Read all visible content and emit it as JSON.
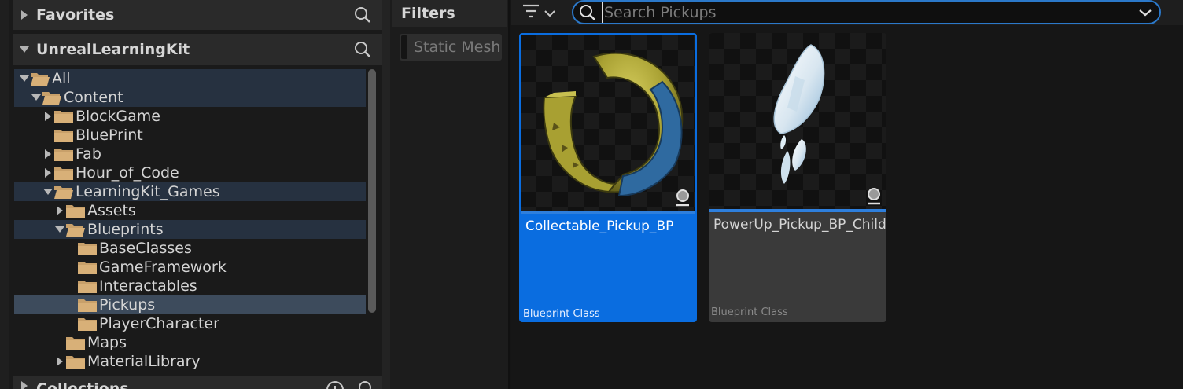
{
  "colors": {
    "accent": "#0a6de0",
    "folder": "#c8a06a",
    "selected_row": "#3d4b5c",
    "path_row": "#263140"
  },
  "sources": {
    "favorites": {
      "title": "Favorites",
      "icon": "search-icon"
    },
    "project": {
      "title": "UnrealLearningKit",
      "icon": "search-icon"
    },
    "collections": {
      "title": "Collections",
      "icons": [
        "add-icon",
        "search-icon"
      ]
    },
    "tree": [
      {
        "label": "All",
        "depth": 0,
        "arrow": "down",
        "open": true,
        "state": "path"
      },
      {
        "label": "Content",
        "depth": 1,
        "arrow": "down",
        "open": true,
        "state": "path"
      },
      {
        "label": "BlockGame",
        "depth": 2,
        "arrow": "right",
        "open": false,
        "state": ""
      },
      {
        "label": "BluePrint",
        "depth": 2,
        "arrow": "none",
        "open": false,
        "state": ""
      },
      {
        "label": "Fab",
        "depth": 2,
        "arrow": "right",
        "open": false,
        "state": ""
      },
      {
        "label": "Hour_of_Code",
        "depth": 2,
        "arrow": "right",
        "open": false,
        "state": ""
      },
      {
        "label": "LearningKit_Games",
        "depth": 2,
        "arrow": "down",
        "open": true,
        "state": "path"
      },
      {
        "label": "Assets",
        "depth": 3,
        "arrow": "right",
        "open": false,
        "state": ""
      },
      {
        "label": "Blueprints",
        "depth": 3,
        "arrow": "down",
        "open": true,
        "state": "path"
      },
      {
        "label": "BaseClasses",
        "depth": 4,
        "arrow": "none",
        "open": false,
        "state": ""
      },
      {
        "label": "GameFramework",
        "depth": 4,
        "arrow": "none",
        "open": false,
        "state": ""
      },
      {
        "label": "Interactables",
        "depth": 4,
        "arrow": "none",
        "open": false,
        "state": ""
      },
      {
        "label": "Pickups",
        "depth": 4,
        "arrow": "none",
        "open": false,
        "state": "selected"
      },
      {
        "label": "PlayerCharacter",
        "depth": 4,
        "arrow": "none",
        "open": false,
        "state": ""
      },
      {
        "label": "Maps",
        "depth": 3,
        "arrow": "none",
        "open": false,
        "state": ""
      },
      {
        "label": "MaterialLibrary",
        "depth": 3,
        "arrow": "right",
        "open": false,
        "state": ""
      }
    ]
  },
  "filters": {
    "title": "Filters",
    "chip": "Static Mesh"
  },
  "toolbar": {
    "filter_icon": "filter-icon",
    "search_placeholder": "Search Pickups",
    "search_value": ""
  },
  "assets": [
    {
      "name": "Collectable_Pickup_BP",
      "type": "Blueprint Class",
      "thumb": "ring-pickup",
      "selected": true
    },
    {
      "name": "PowerUp_Pickup_BP_Child",
      "type": "Blueprint Class",
      "thumb": "crystal-pickup",
      "selected": false
    }
  ]
}
